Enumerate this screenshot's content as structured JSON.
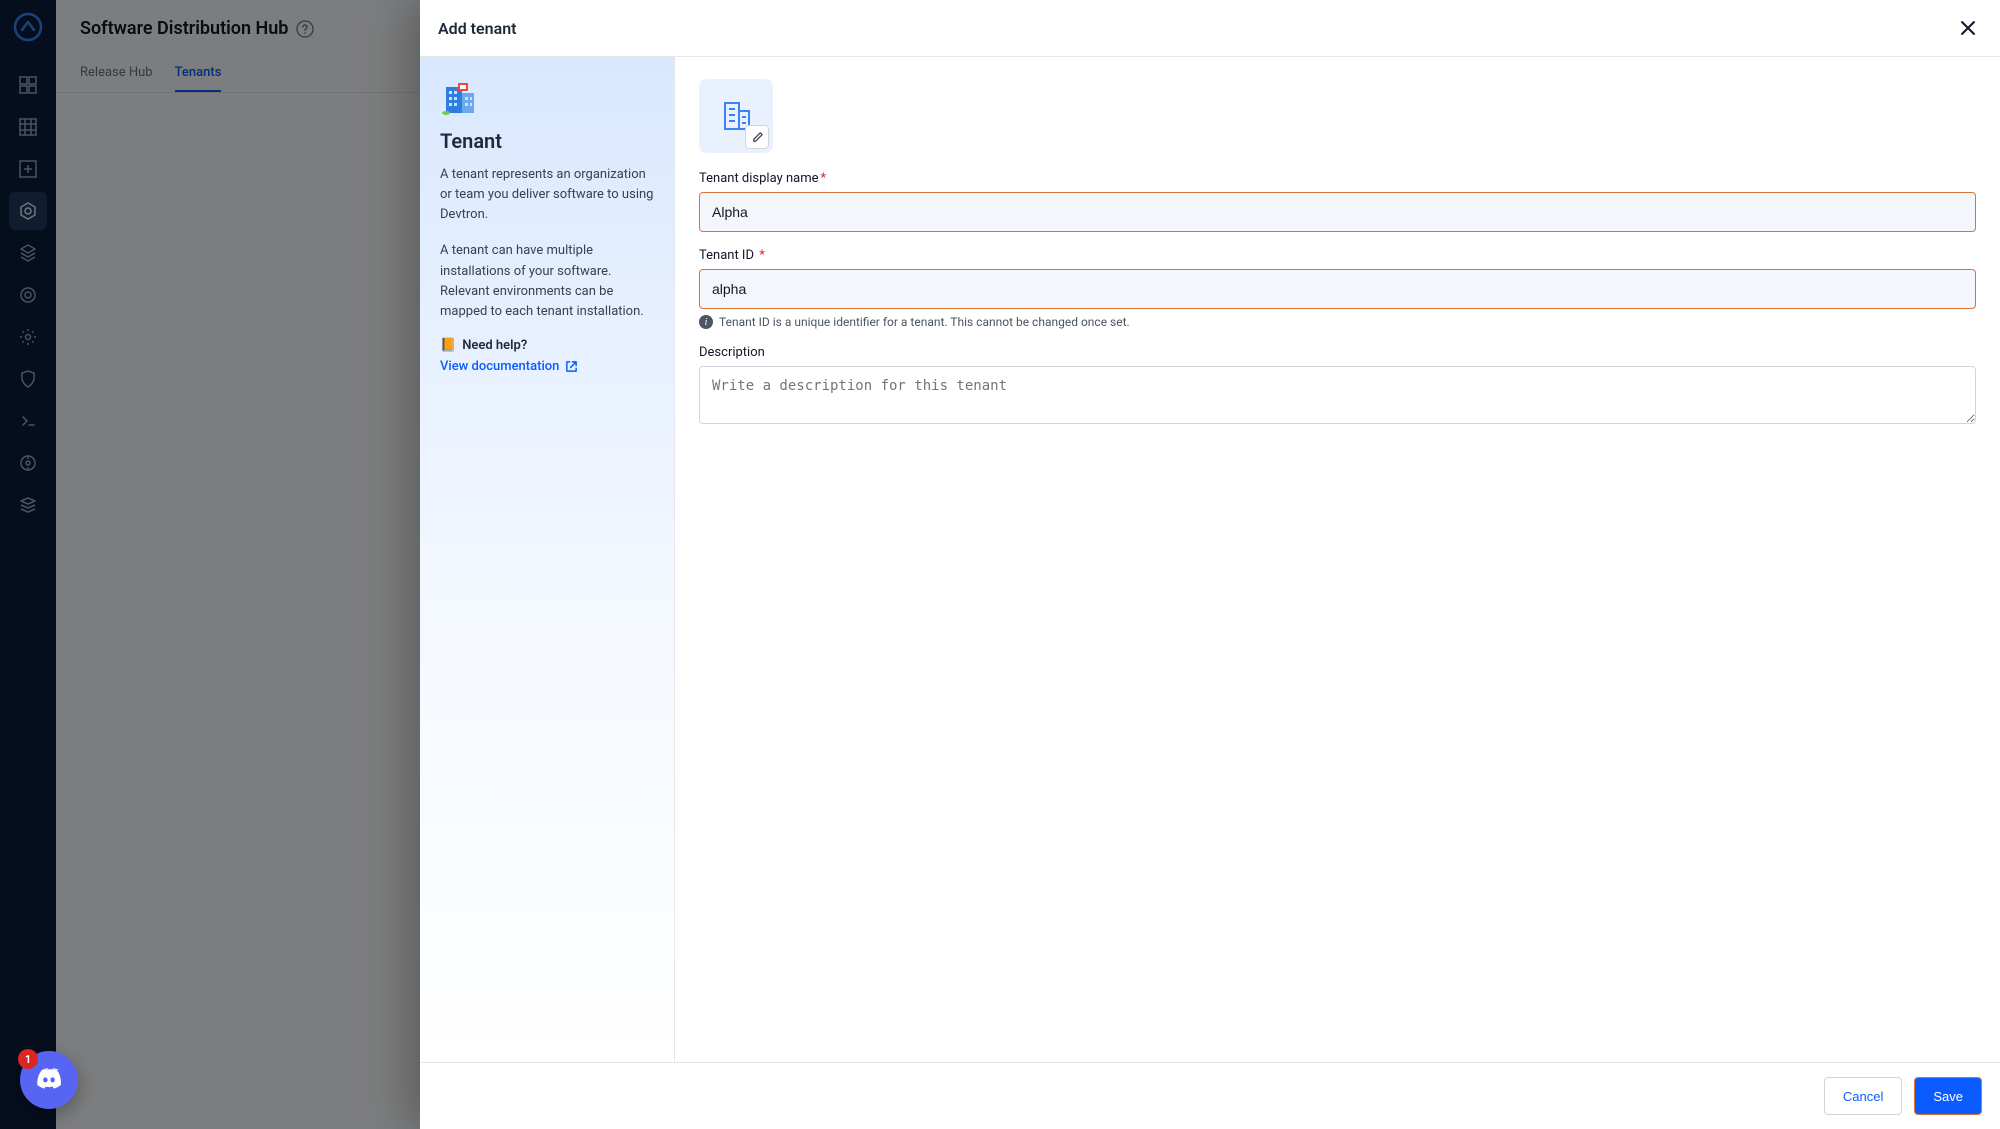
{
  "page": {
    "title": "Software Distribution Hub",
    "tabs": [
      {
        "label": "Release Hub",
        "active": false
      },
      {
        "label": "Tenants",
        "active": true
      }
    ]
  },
  "nav": {
    "items": [
      {
        "name": "dashboard-icon"
      },
      {
        "name": "grid-icon"
      },
      {
        "name": "add-panel-icon"
      },
      {
        "name": "distribution-icon"
      },
      {
        "name": "registry-icon"
      },
      {
        "name": "target-icon"
      },
      {
        "name": "settings-icon"
      },
      {
        "name": "security-icon"
      },
      {
        "name": "terminal-icon"
      },
      {
        "name": "operations-icon"
      },
      {
        "name": "stacks-icon"
      }
    ],
    "active_index": 3
  },
  "drawer": {
    "title": "Add tenant",
    "info": {
      "heading": "Tenant",
      "para1": "A tenant represents an organization or team you deliver software to using Devtron.",
      "para2": "A tenant can have multiple installations of your software. Relevant environments can be mapped to each tenant installation.",
      "help_label": "Need help?",
      "doc_link_label": "View documentation"
    },
    "form": {
      "display_name_label": "Tenant display name",
      "display_name_value": "Alpha",
      "tenant_id_label": "Tenant ID",
      "tenant_id_value": "alpha",
      "tenant_id_hint": "Tenant ID is a unique identifier for a tenant. This cannot be changed once set.",
      "description_label": "Description",
      "description_value": "",
      "description_placeholder": "Write a description for this tenant"
    },
    "footer": {
      "cancel_label": "Cancel",
      "save_label": "Save"
    }
  },
  "fab": {
    "badge_count": "1"
  }
}
